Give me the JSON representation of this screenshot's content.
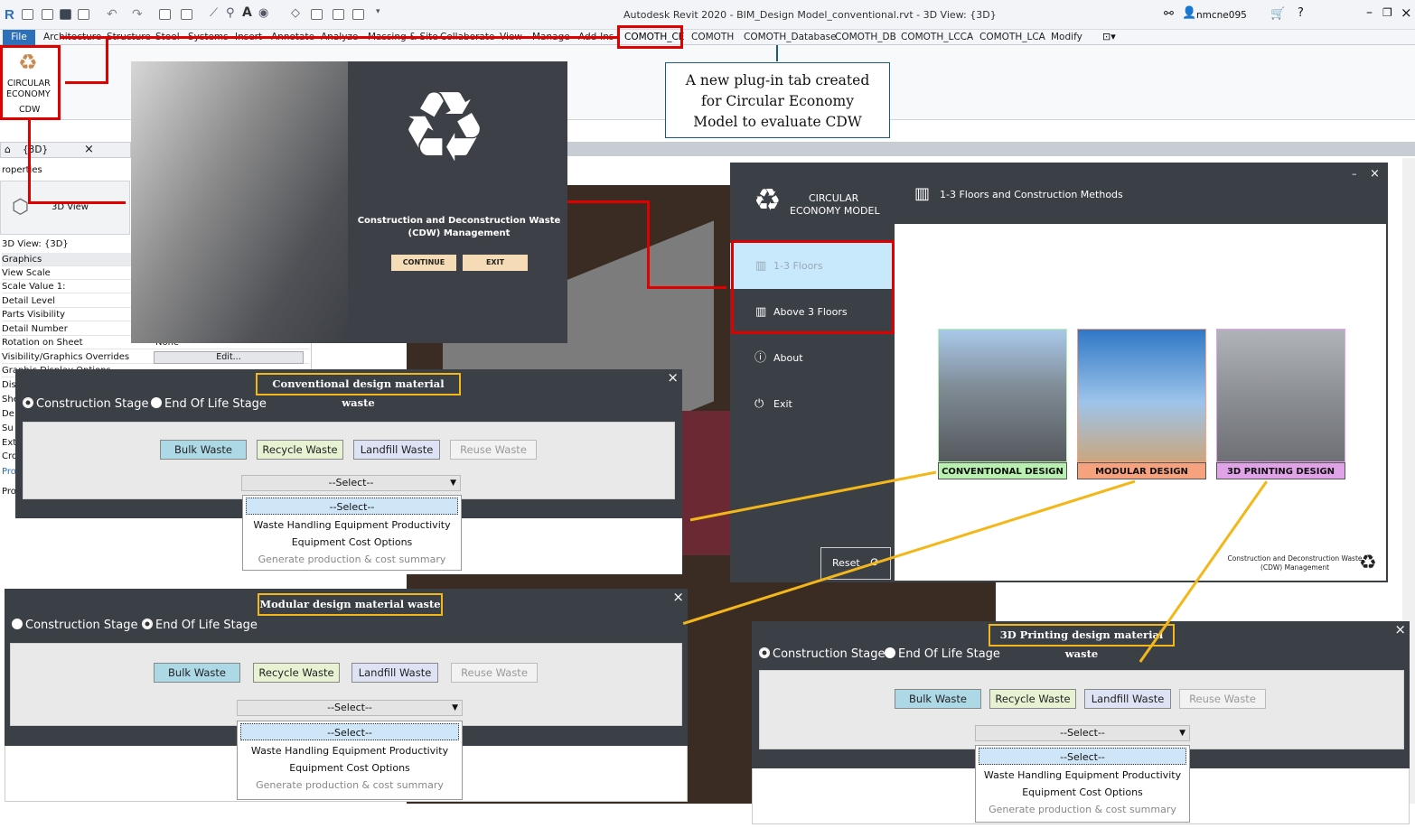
{
  "app": {
    "title": "Autodesk Revit 2020 - BIM_Design Model_conventional.rvt - 3D View: {3D}",
    "user": "nmcne095"
  },
  "ribbon_tabs": [
    "File",
    "Architecture",
    "Structure",
    "Steel",
    "Systems",
    "Insert",
    "Annotate",
    "Analyze",
    "Massing & Site",
    "Collaborate",
    "View",
    "Manage",
    "Add-Ins",
    "COMOTH_CE",
    "COMOTH",
    "COMOTH_Database",
    "COMOTH_DB",
    "COMOTH_LCCA",
    "COMOTH_LCA",
    "Modify"
  ],
  "ribbon_button": {
    "line1": "CIRCULAR",
    "line2": "ECONOMY",
    "panel": "CDW"
  },
  "callout": "A new plug-in tab created for Circular Economy Model to evaluate CDW",
  "properties": {
    "tab_label": "{3D}",
    "header": "roperties",
    "type_name": "3D View",
    "view_label": "3D View: {3D}",
    "rows": [
      "Graphics",
      "View Scale",
      "Scale Value    1:",
      "Detail Level",
      "Parts Visibility",
      "Detail Number",
      "Rotation on Sheet",
      "Visibility/Graphics Overrides",
      "Graphic Display Options"
    ],
    "rotation_value": "None",
    "edit_label": "Edit...",
    "cut_rows": [
      "Dis",
      "She",
      "De",
      "Su",
      "Exte",
      "Cro",
      "Prop",
      "Pro"
    ]
  },
  "splash": {
    "title": "Construction and Deconstruction Waste (CDW) Management",
    "continue": "CONTINUE",
    "exit": "EXIT"
  },
  "ce_model": {
    "logo_line1": "CIRCULAR",
    "logo_line2": "ECONOMY MODEL",
    "header": "1-3 Floors and Construction Methods",
    "menu": [
      "1-3 Floors",
      "Above 3 Floors",
      "About",
      "Exit"
    ],
    "cards": [
      "CONVENTIONAL DESIGN",
      "MODULAR DESIGN",
      "3D PRINTING DESIGN"
    ],
    "reset": "Reset",
    "footer": "Construction and Deconstruction Waste (CDW) Management",
    "colors": {
      "conventional": "#b7f0b0",
      "modular": "#f7a27f",
      "printing": "#e0a3e8",
      "active": "#c8e9fb"
    }
  },
  "waste_windows": [
    {
      "title": "Conventional design material waste",
      "radio1": "Construction Stage",
      "radio2": "End Of Life Stage",
      "buttons": [
        "Bulk Waste",
        "Recycle Waste",
        "Landfill Waste",
        "Reuse Waste"
      ],
      "select": "--Select--",
      "options": [
        "--Select--",
        "Waste Handling Equipment Productivity",
        "Equipment Cost Options",
        "Generate production & cost summary"
      ]
    },
    {
      "title": "Modular design material waste",
      "radio1": "Construction Stage",
      "radio2": "End Of Life Stage",
      "buttons": [
        "Bulk Waste",
        "Recycle Waste",
        "Landfill Waste",
        "Reuse Waste"
      ],
      "select": "--Select--",
      "options": [
        "--Select--",
        "Waste Handling Equipment Productivity",
        "Equipment Cost Options",
        "Generate production & cost summary"
      ]
    },
    {
      "title": "3D Printing design material waste",
      "radio1": "Construction Stage",
      "radio2": "End Of Life Stage",
      "buttons": [
        "Bulk Waste",
        "Recycle Waste",
        "Landfill Waste",
        "Reuse Waste"
      ],
      "select": "--Select--",
      "options": [
        "--Select--",
        "Waste Handling Equipment Productivity",
        "Equipment Cost Options",
        "Generate production & cost summary"
      ]
    }
  ]
}
